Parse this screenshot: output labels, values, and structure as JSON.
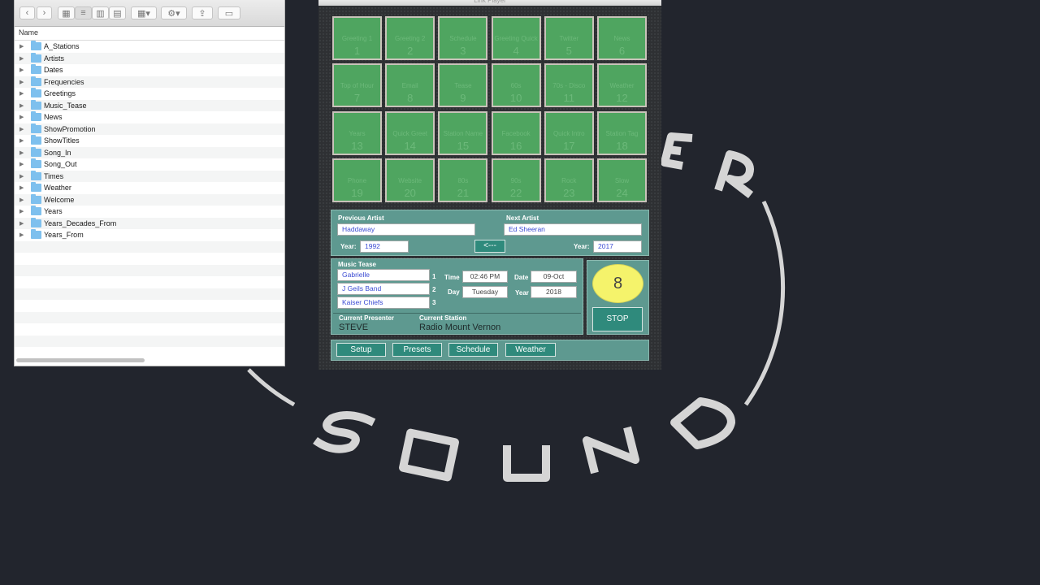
{
  "finder": {
    "column_header": "Name",
    "folders": [
      "A_Stations",
      "Artists",
      "Dates",
      "Frequencies",
      "Greetings",
      "Music_Tease",
      "News",
      "ShowPromotion",
      "ShowTitles",
      "Song_In",
      "Song_Out",
      "Times",
      "Weather",
      "Welcome",
      "Years",
      "Years_Decades_From",
      "Years_From"
    ]
  },
  "player": {
    "title": "Link Player",
    "cells": [
      {
        "label": "Greeting 1",
        "num": "1"
      },
      {
        "label": "Greeting 2",
        "num": "2"
      },
      {
        "label": "Schedule",
        "num": "3"
      },
      {
        "label": "Greeting Quick",
        "num": "4"
      },
      {
        "label": "Twitter",
        "num": "5"
      },
      {
        "label": "News",
        "num": "6"
      },
      {
        "label": "Top of Hour",
        "num": "7"
      },
      {
        "label": "Email",
        "num": "8"
      },
      {
        "label": "Tease",
        "num": "9"
      },
      {
        "label": "60s",
        "num": "10"
      },
      {
        "label": "70s - Disco",
        "num": "11"
      },
      {
        "label": "Weather",
        "num": "12"
      },
      {
        "label": "Years",
        "num": "13"
      },
      {
        "label": "Quick Greet",
        "num": "14"
      },
      {
        "label": "Station Name",
        "num": "15"
      },
      {
        "label": "Facebook",
        "num": "16"
      },
      {
        "label": "Quick Intro",
        "num": "17"
      },
      {
        "label": "Station Tag",
        "num": "18"
      },
      {
        "label": "Phone",
        "num": "19"
      },
      {
        "label": "Website",
        "num": "20"
      },
      {
        "label": "80s",
        "num": "21"
      },
      {
        "label": "90s",
        "num": "22"
      },
      {
        "label": "Rock",
        "num": "23"
      },
      {
        "label": "Slow",
        "num": "24"
      }
    ],
    "previous_artist_label": "Previous Artist",
    "previous_artist": "Haddaway",
    "next_artist_label": "Next Artist",
    "next_artist": "Ed Sheeran",
    "year_label": "Year:",
    "prev_year": "1992",
    "next_year": "2017",
    "swap_button": "<---",
    "music_tease_label": "Music Tease",
    "tease": [
      "Gabrielle",
      "J Geils Band",
      "Kaiser Chiefs"
    ],
    "tease_nums": [
      "1",
      "2",
      "3"
    ],
    "time_label": "Time",
    "time": "02:46 PM",
    "date_label": "Date",
    "date": "09-Oct",
    "day_label": "Day",
    "day": "Tuesday",
    "year2_label": "Year",
    "year2": "2018",
    "presenter_label": "Current Presenter",
    "presenter": "STEVE",
    "station_label": "Current Station",
    "station": "Radio Mount Vernon",
    "counter": "8",
    "stop": "STOP",
    "nav": [
      "Setup",
      "Presets",
      "Schedule",
      "Weather"
    ]
  },
  "colors": {
    "cell_green": "#4fa560",
    "panel_teal": "#5e9990",
    "button_teal": "#2f8a7c",
    "counter_yellow": "#f5f36b"
  }
}
